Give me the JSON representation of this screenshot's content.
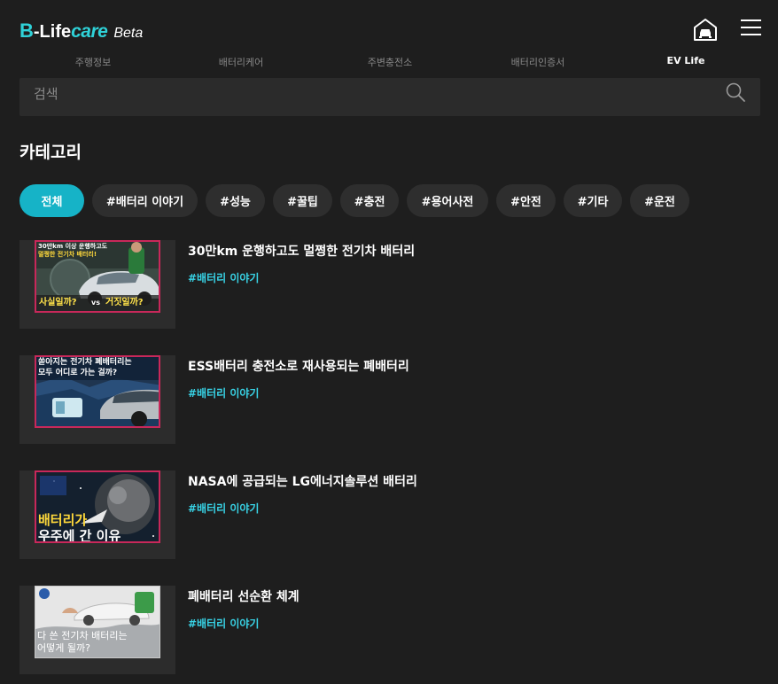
{
  "header": {
    "logo_b": "B",
    "logo_life": "-Life",
    "logo_care": "care",
    "logo_beta": "Beta",
    "garage_icon": "garage-icon",
    "menu_icon": "hamburger-menu-icon"
  },
  "nav": {
    "tabs": [
      {
        "label": "주행정보",
        "active": false
      },
      {
        "label": "배터리케어",
        "active": false
      },
      {
        "label": "주변충전소",
        "active": false
      },
      {
        "label": "배터리인증서",
        "active": false
      },
      {
        "label": "EV Life",
        "active": true
      }
    ]
  },
  "search": {
    "placeholder": "검색",
    "value": "",
    "icon": "search-icon"
  },
  "category": {
    "title": "카테고리",
    "chips": [
      {
        "label": "전체",
        "active": true
      },
      {
        "label": "#배터리 이야기",
        "active": false
      },
      {
        "label": "#성능",
        "active": false
      },
      {
        "label": "#꿀팁",
        "active": false
      },
      {
        "label": "#충전",
        "active": false
      },
      {
        "label": "#용어사전",
        "active": false
      },
      {
        "label": "#안전",
        "active": false
      },
      {
        "label": "#기타",
        "active": false
      },
      {
        "label": "#운전",
        "active": false
      }
    ]
  },
  "articles": [
    {
      "title": "30만km 운행하고도 멀쩡한 전기차 배터리",
      "tag": "#배터리 이야기",
      "thumb_text": [
        "30만km 이상 운행하고도",
        "멀쩡한 전기차 배터리!",
        "사실일까?",
        "vs",
        "거짓일까?"
      ]
    },
    {
      "title": "ESS배터리 충전소로 재사용되는 폐배터리",
      "tag": "#배터리 이야기",
      "thumb_text": [
        "쏟아지는 전기차 폐배터리는",
        "모두 어디로 가는 걸까?"
      ]
    },
    {
      "title": "NASA에 공급되는 LG에너지솔루션 배터리",
      "tag": "#배터리 이야기",
      "thumb_text": [
        "배터리가",
        "우주에 간 이유"
      ]
    },
    {
      "title": "폐배터리 선순환 체계",
      "tag": "#배터리 이야기",
      "thumb_text": [
        "다 쓴 전기차 배터리는",
        "어떻게 될까?"
      ]
    }
  ],
  "colors": {
    "background": "#1e1e1e",
    "accent": "#16b3c7",
    "tag": "#38d3e6",
    "chip": "#2e2e2e",
    "search_bg": "#2b2b2b"
  }
}
